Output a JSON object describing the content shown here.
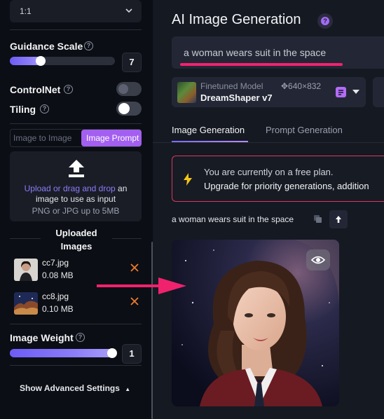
{
  "sidebar": {
    "ratio_value": "1:1",
    "guidance": {
      "label": "Guidance Scale",
      "value": "7",
      "fill_fraction": 0.31
    },
    "controlnet": {
      "label": "ControlNet",
      "on": false
    },
    "tiling": {
      "label": "Tiling",
      "on": false
    },
    "mode_tabs": [
      "Image to Image",
      "Image Prompt"
    ],
    "active_mode": "Image Prompt",
    "upload": {
      "link_text": "Upload or drag and drop",
      "line1_rest": " an",
      "line2": "image to use as input",
      "hint": "PNG or JPG up to 5MB"
    },
    "uploaded_title": "Uploaded Images",
    "files": [
      {
        "name": "cc7.jpg",
        "size": "0.08 MB"
      },
      {
        "name": "cc8.jpg",
        "size": "0.10 MB"
      }
    ],
    "image_weight": {
      "label": "Image Weight",
      "value": "1",
      "fill_fraction": 0.98
    },
    "advanced_label": "Show Advanced Settings"
  },
  "main": {
    "title": "AI Image Generation",
    "prompt_text": "a woman wears suit in the space",
    "model": {
      "caption": "Finetuned Model",
      "name": "DreamShaper v7",
      "dims": "✥640×832"
    },
    "tabs": [
      "Image Generation",
      "Prompt Generation"
    ],
    "active_tab": "Image Generation",
    "banner": {
      "line1": "You are currently on a free plan.",
      "line2": "Upgrade for priority generations, addition"
    },
    "result_prompt": "a woman wears suit in the space"
  },
  "colors": {
    "accent_purple": "#8b7cf8",
    "tab_active": "#a35ff0",
    "alert_pink": "#f0226e",
    "close_orange": "#f07a2a"
  }
}
